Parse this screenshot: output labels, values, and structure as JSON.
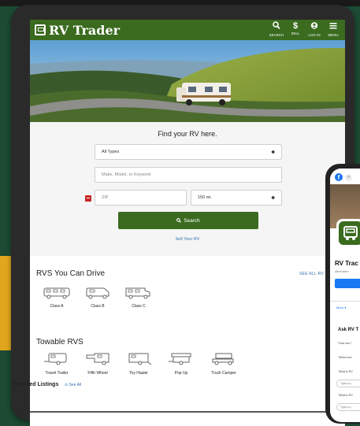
{
  "header": {
    "logo_text": "RV Trader",
    "nav": [
      {
        "label": "SEARCH",
        "icon": "search-icon"
      },
      {
        "label": "SELL",
        "icon": "dollar-icon"
      },
      {
        "label": "LOG IN",
        "icon": "user-icon"
      },
      {
        "label": "MENU",
        "icon": "hamburger-icon"
      }
    ]
  },
  "search": {
    "title": "Find your RV here.",
    "type_select": "All Types",
    "keyword_placeholder": "Make, Model, or Keyword",
    "zip_placeholder": "ZIP",
    "distance_select": "150 mi.",
    "search_button": "Search",
    "sell_link": "Sell Your RV"
  },
  "drivable": {
    "title": "RVS You Can Drive",
    "see_all": "SEE ALL RV",
    "items": [
      "Class A",
      "Class B",
      "Class C"
    ]
  },
  "towable": {
    "title": "Towable RVS",
    "items": [
      "Travel Trailer",
      "Fifth Wheel",
      "Toy Hauler",
      "Pop Up",
      "Truck Camper"
    ]
  },
  "featured": {
    "title": "Featured Listings",
    "see_all": "See All"
  },
  "phone": {
    "page_name": "RV Trac",
    "handle": "@rvtrader · ",
    "more": "More ▾",
    "ask_title": "Ask RV T",
    "questions": [
      "\"How can I",
      "\"Where are",
      "\"What is RV",
      "\"What is RV"
    ],
    "input_placeholder": "Type a q"
  },
  "colors": {
    "brand_green": "#3a6b1f",
    "link_blue": "#2f6fb3",
    "background": "#1c4a33"
  }
}
